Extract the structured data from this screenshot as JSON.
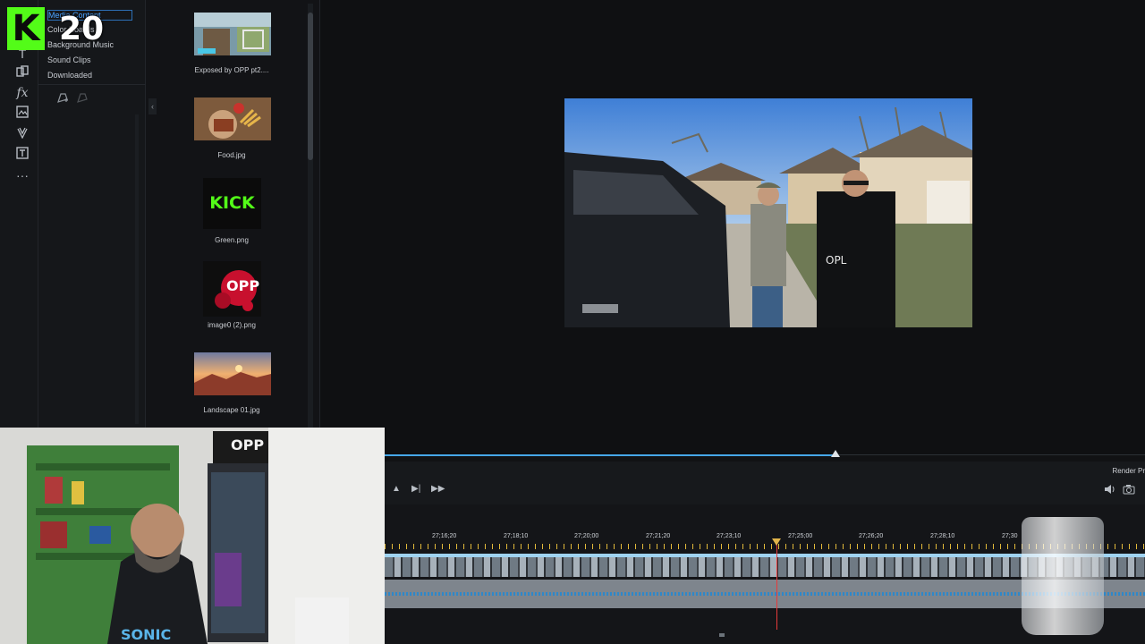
{
  "badge": {
    "letter": "K",
    "count": "20"
  },
  "categories": {
    "items": [
      {
        "label": "Media Content",
        "selected": true
      },
      {
        "label": "Color Boards",
        "selected": false
      },
      {
        "label": "Background Music",
        "selected": false
      },
      {
        "label": "Sound Clips",
        "selected": false
      },
      {
        "label": "Downloaded",
        "selected": false
      }
    ]
  },
  "media": {
    "items": [
      {
        "label": "Exposed by OPP pt2...."
      },
      {
        "label": "Food.jpg"
      },
      {
        "label": "Green.png",
        "thumb_text": "KICK"
      },
      {
        "label": "image0 (2).png",
        "thumb_text": "OPP"
      },
      {
        "label": "Landscape 01.jpg"
      }
    ]
  },
  "timeline": {
    "render_label": "Render Pr",
    "timecodes": [
      "27;16;20",
      "27;18;10",
      "27;20;00",
      "27;21;20",
      "27;23;10",
      "27;25;00",
      "27;26;20",
      "27;28;10",
      "27;30"
    ]
  },
  "webcam": {
    "shirt_text": "SONIC",
    "sign_text": "OPP"
  },
  "colors": {
    "accent": "#46a7e8",
    "kick_green": "#53fc18",
    "playhead": "#e63b3b"
  },
  "icons": [
    "media-icon",
    "text-icon",
    "transition-icon",
    "fx-icon",
    "overlay-icon",
    "particle-icon",
    "title-icon",
    "more-icon"
  ]
}
